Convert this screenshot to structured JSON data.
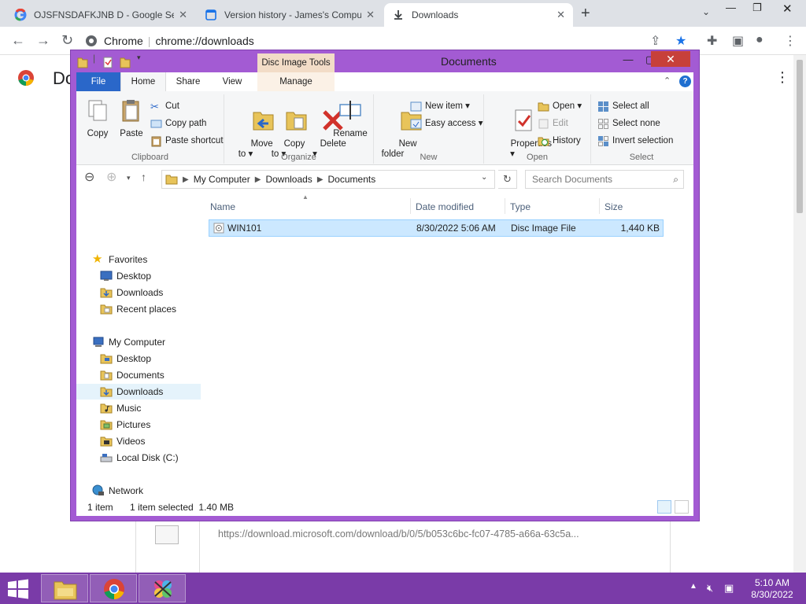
{
  "browser": {
    "tabs": [
      {
        "label": "OJSFNSDAFKJNB D - Google Sea",
        "icon": "google-g-icon"
      },
      {
        "label": "Version history - James's Comput",
        "icon": "docs-icon"
      },
      {
        "label": "Downloads",
        "icon": "download-icon",
        "active": true
      }
    ],
    "site_label": "Chrome",
    "url": "chrome://downloads",
    "page_title": "Do",
    "download_url": "https://download.microsoft.com/download/b/0/5/b053c6bc-fc07-4785-a66a-63c5a..."
  },
  "explorer": {
    "title": "Documents",
    "contextual_tab_group": "Disc Image Tools",
    "tabs": {
      "file": "File",
      "home": "Home",
      "share": "Share",
      "view": "View",
      "manage": "Manage"
    },
    "ribbon": {
      "clipboard": {
        "label": "Clipboard",
        "copy": "Copy",
        "paste": "Paste",
        "cut": "Cut",
        "copy_path": "Copy path",
        "paste_shortcut": "Paste shortcut"
      },
      "organize": {
        "label": "Organize",
        "move_to": "Move\nto ▾",
        "copy_to": "Copy\nto ▾",
        "delete": "Delete\n▾",
        "rename": "Rename"
      },
      "new": {
        "label": "New",
        "new_folder": "New\nfolder",
        "new_item": "New item ▾",
        "easy_access": "Easy access ▾"
      },
      "open": {
        "label": "Open",
        "properties": "Properties\n▾",
        "open": "Open ▾",
        "edit": "Edit",
        "history": "History"
      },
      "select": {
        "label": "Select",
        "select_all": "Select all",
        "select_none": "Select none",
        "invert": "Invert selection"
      }
    },
    "address": {
      "segments": [
        "My Computer",
        "Downloads",
        "Documents"
      ],
      "search_placeholder": "Search Documents"
    },
    "nav": {
      "favorites": "Favorites",
      "favorites_items": [
        "Desktop",
        "Downloads",
        "Recent places"
      ],
      "computer": "My Computer",
      "computer_items": [
        "Desktop",
        "Documents",
        "Downloads",
        "Music",
        "Pictures",
        "Videos",
        "Local Disk (C:)"
      ],
      "network": "Network"
    },
    "columns": {
      "name": "Name",
      "date": "Date modified",
      "type": "Type",
      "size": "Size"
    },
    "files": [
      {
        "name": "WIN101",
        "date": "8/30/2022 5:06 AM",
        "type": "Disc Image File",
        "size": "1,440 KB"
      }
    ],
    "status": {
      "count": "1 item",
      "selected": "1 item selected  1.40 MB"
    }
  },
  "taskbar": {
    "time": "5:10 AM",
    "date": "8/30/2022",
    "accent": "#7a3ba8"
  }
}
